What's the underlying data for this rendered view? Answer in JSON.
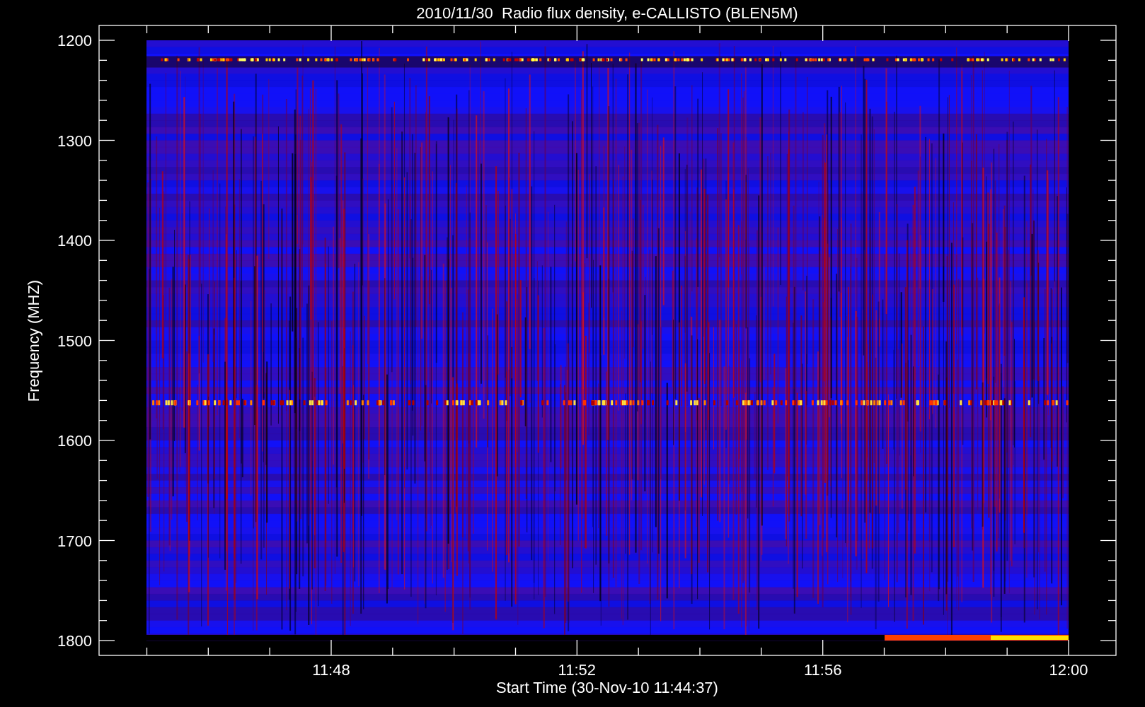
{
  "title": "2010/11/30  Radio flux density, e-CALLISTO (BLEN5M)",
  "y_axis": {
    "label": "Frequency (MHZ)",
    "ticks": [
      "1200",
      "1300",
      "1400",
      "1500",
      "1600",
      "1700",
      "1800"
    ]
  },
  "x_axis": {
    "label": "Start Time (30-Nov-10 11:44:37)",
    "ticks": [
      "11:48",
      "11:52",
      "11:56",
      "12:00"
    ]
  }
}
